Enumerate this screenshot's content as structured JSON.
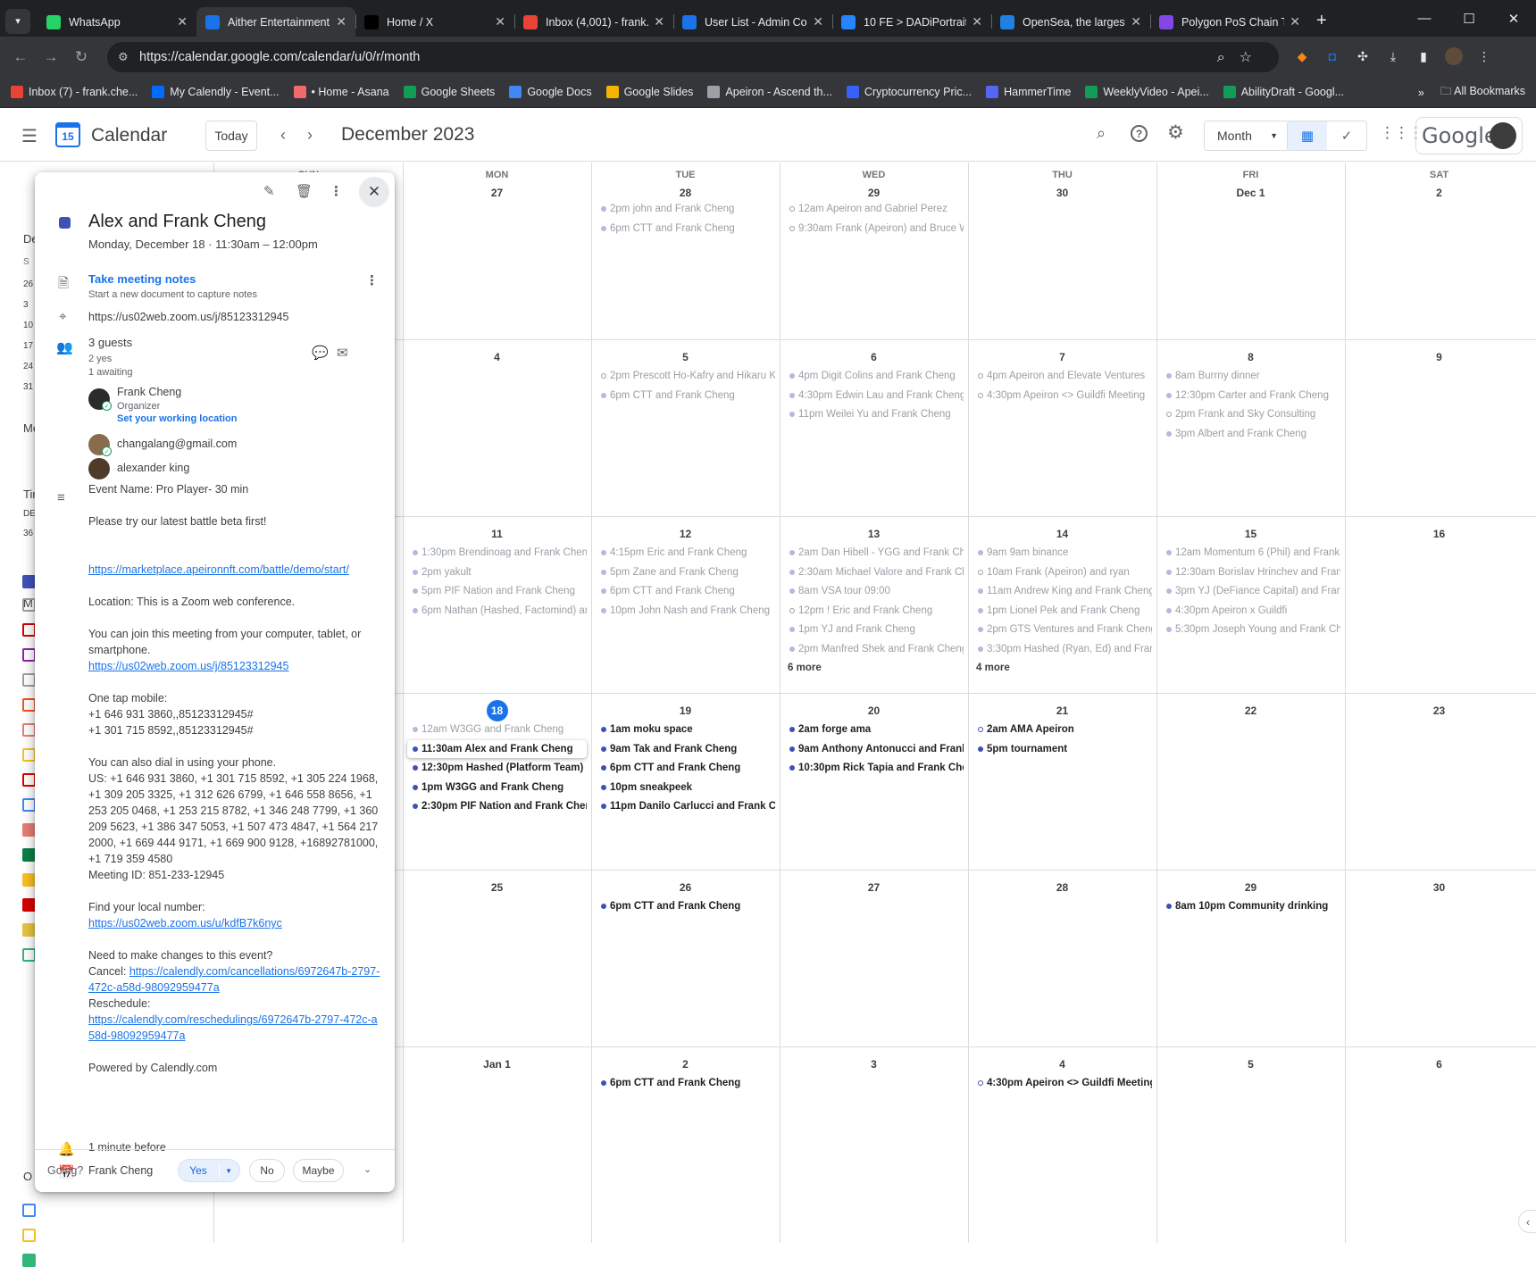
{
  "browser": {
    "tabs": [
      {
        "title": "WhatsApp",
        "icon": "whatsapp-icon",
        "color": "#25d366",
        "active": false
      },
      {
        "title": "Aither Entertainment",
        "icon": "calendar-icon",
        "color": "#1a73e8",
        "active": true
      },
      {
        "title": "Home / X",
        "icon": "x-icon",
        "color": "#000000",
        "active": false
      },
      {
        "title": "Inbox (4,001) - frank.",
        "icon": "gmail-icon",
        "color": "#ea4335",
        "active": false
      },
      {
        "title": "User List - Admin Co",
        "icon": "admin-icon",
        "color": "#1a73e8",
        "active": false
      },
      {
        "title": "10 FE > DADiPortrait",
        "icon": "jira-icon",
        "color": "#2684ff",
        "active": false
      },
      {
        "title": "OpenSea, the largest",
        "icon": "opensea-icon",
        "color": "#2081e2",
        "active": false
      },
      {
        "title": "Polygon PoS Chain Tr",
        "icon": "polygon-icon",
        "color": "#8247e5",
        "active": false
      }
    ],
    "url": "https://calendar.google.com/calendar/u/0/r/month",
    "bookmarks": [
      {
        "label": "Inbox (7) - frank.che...",
        "color": "#ea4335"
      },
      {
        "label": "My Calendly - Event...",
        "color": "#006bff"
      },
      {
        "label": "• Home - Asana",
        "color": "#f06a6a"
      },
      {
        "label": "Google Sheets",
        "color": "#0f9d58"
      },
      {
        "label": "Google Docs",
        "color": "#4285f4"
      },
      {
        "label": "Google Slides",
        "color": "#f4b400"
      },
      {
        "label": "Apeiron - Ascend th...",
        "color": "#9aa0a6"
      },
      {
        "label": "Cryptocurrency Pric...",
        "color": "#3861fb"
      },
      {
        "label": "HammerTime",
        "color": "#5865f2"
      },
      {
        "label": "WeeklyVideo - Apei...",
        "color": "#0f9d58"
      },
      {
        "label": "AbilityDraft - Googl...",
        "color": "#0f9d58"
      }
    ],
    "all_bookmarks": "All Bookmarks",
    "overflow": "»"
  },
  "header": {
    "app_title": "Calendar",
    "logo_day": "15",
    "today_button": "Today",
    "month_title": "December 2023",
    "view_select": "Month",
    "google_wordmark": "Google"
  },
  "sidebar_peek": {
    "month_letter": "De",
    "dow": "S",
    "weeks": [
      "26",
      "3",
      "10",
      "17",
      "24",
      "31"
    ],
    "sec1": "Me",
    "sec2": "Tir",
    "sec2b": "DE",
    "sec2c": "36",
    "sec3": "M",
    "sec4": "O",
    "checkbox_colors": [
      "#3f51b5",
      "#9aa0a6",
      "#d50000",
      "#8e24aa",
      "#9aa0a6",
      "#f4511e",
      "#e67c73",
      "#f6bf26",
      "#d50000",
      "#4285f4",
      "#e67c73",
      "#0b8043",
      "#f6bf26",
      "#d50000",
      "#e4c441",
      "#33b679",
      "#4285f4",
      "#f6bf26",
      "#33b679"
    ]
  },
  "grid": {
    "weekday_headers": [
      "SUN",
      "MON",
      "TUE",
      "WED",
      "THU",
      "FRI",
      "SAT"
    ],
    "weeks": [
      {
        "days": [
          "26",
          "27",
          "28",
          "29",
          "30",
          "Dec 1",
          "2"
        ]
      },
      {
        "days": [
          "3",
          "4",
          "5",
          "6",
          "7",
          "8",
          "9"
        ]
      },
      {
        "days": [
          "10",
          "11",
          "12",
          "13",
          "14",
          "15",
          "16"
        ]
      },
      {
        "days": [
          "17",
          "18",
          "19",
          "20",
          "21",
          "22",
          "23"
        ]
      },
      {
        "days": [
          "24",
          "25",
          "26",
          "27",
          "28",
          "29",
          "30"
        ]
      },
      {
        "days": [
          "31",
          "Jan 1",
          "2",
          "3",
          "4",
          "5",
          "6"
        ]
      }
    ],
    "today": {
      "week": 3,
      "col": 1
    },
    "events": [
      {
        "w": 0,
        "c": 2,
        "i": 0,
        "time": "2pm",
        "title": "john and Frank Cheng",
        "kind": "past"
      },
      {
        "w": 0,
        "c": 2,
        "i": 1,
        "time": "6pm",
        "title": "CTT and Frank Cheng",
        "kind": "past"
      },
      {
        "w": 0,
        "c": 3,
        "i": 0,
        "time": "12am",
        "title": "Apeiron and Gabriel Perez",
        "kind": "past pend"
      },
      {
        "w": 0,
        "c": 3,
        "i": 1,
        "time": "9:30am",
        "title": "Frank (Apeiron) and Bruce Wa",
        "kind": "past pend"
      },
      {
        "w": 1,
        "c": 2,
        "i": 0,
        "time": "2pm",
        "title": "Prescott Ho-Kafry and Hikaru Ka",
        "kind": "past pend"
      },
      {
        "w": 1,
        "c": 2,
        "i": 1,
        "time": "6pm",
        "title": "CTT and Frank Cheng",
        "kind": "past"
      },
      {
        "w": 1,
        "c": 3,
        "i": 0,
        "time": "4pm",
        "title": "Digit Colins and Frank Cheng",
        "kind": "past"
      },
      {
        "w": 1,
        "c": 3,
        "i": 1,
        "time": "4:30pm",
        "title": "Edwin Lau and Frank Cheng",
        "kind": "past"
      },
      {
        "w": 1,
        "c": 3,
        "i": 2,
        "time": "11pm",
        "title": "Weilei Yu and Frank Cheng",
        "kind": "past"
      },
      {
        "w": 1,
        "c": 4,
        "i": 0,
        "time": "4pm",
        "title": "Apeiron and Elevate Ventures",
        "kind": "past pend"
      },
      {
        "w": 1,
        "c": 4,
        "i": 1,
        "time": "4:30pm",
        "title": "Apeiron <> Guildfi Meeting",
        "kind": "past pend"
      },
      {
        "w": 1,
        "c": 5,
        "i": 0,
        "time": "8am",
        "title": "Burrny dinner",
        "kind": "past"
      },
      {
        "w": 1,
        "c": 5,
        "i": 1,
        "time": "12:30pm",
        "title": "Carter and Frank Cheng",
        "kind": "past"
      },
      {
        "w": 1,
        "c": 5,
        "i": 2,
        "time": "2pm",
        "title": "Frank and Sky Consulting",
        "kind": "past pend"
      },
      {
        "w": 1,
        "c": 5,
        "i": 3,
        "time": "3pm",
        "title": "Albert and Frank Cheng",
        "kind": "past"
      },
      {
        "w": 2,
        "c": 1,
        "i": 0,
        "time": "1:30pm",
        "title": "Brendinoag and Frank Cheng",
        "kind": "past"
      },
      {
        "w": 2,
        "c": 1,
        "i": 1,
        "time": "2pm",
        "title": "yakult",
        "kind": "past"
      },
      {
        "w": 2,
        "c": 1,
        "i": 2,
        "time": "5pm",
        "title": "PIF Nation and Frank Cheng",
        "kind": "past"
      },
      {
        "w": 2,
        "c": 1,
        "i": 3,
        "time": "6pm",
        "title": "Nathan (Hashed, Factomind) and",
        "kind": "past"
      },
      {
        "w": 2,
        "c": 2,
        "i": 0,
        "time": "4:15pm",
        "title": "Eric and Frank Cheng",
        "kind": "past"
      },
      {
        "w": 2,
        "c": 2,
        "i": 1,
        "time": "5pm",
        "title": "Zane and Frank Cheng",
        "kind": "past"
      },
      {
        "w": 2,
        "c": 2,
        "i": 2,
        "time": "6pm",
        "title": "CTT and Frank Cheng",
        "kind": "past"
      },
      {
        "w": 2,
        "c": 2,
        "i": 3,
        "time": "10pm",
        "title": "John Nash and Frank Cheng",
        "kind": "past"
      },
      {
        "w": 2,
        "c": 3,
        "i": 0,
        "time": "2am",
        "title": "Dan Hibell - YGG and Frank Cheng",
        "kind": "past"
      },
      {
        "w": 2,
        "c": 3,
        "i": 1,
        "time": "2:30am",
        "title": "Michael Valore and Frank Che",
        "kind": "past"
      },
      {
        "w": 2,
        "c": 3,
        "i": 2,
        "time": "8am",
        "title": "VSA tour 09:00",
        "kind": "past"
      },
      {
        "w": 2,
        "c": 3,
        "i": 3,
        "time": "12pm",
        "title": "! Eric and Frank Cheng",
        "kind": "past pend"
      },
      {
        "w": 2,
        "c": 3,
        "i": 4,
        "time": "1pm",
        "title": "YJ and Frank Cheng",
        "kind": "past"
      },
      {
        "w": 2,
        "c": 3,
        "i": 5,
        "time": "2pm",
        "title": "Manfred Shek and Frank Cheng",
        "kind": "past"
      },
      {
        "w": 2,
        "c": 4,
        "i": 0,
        "time": "9am",
        "title": "9am binance",
        "kind": "past"
      },
      {
        "w": 2,
        "c": 4,
        "i": 1,
        "time": "10am",
        "title": "Frank (Apeiron) and ryan",
        "kind": "past pend"
      },
      {
        "w": 2,
        "c": 4,
        "i": 2,
        "time": "11am",
        "title": "Andrew King and Frank Cheng",
        "kind": "past"
      },
      {
        "w": 2,
        "c": 4,
        "i": 3,
        "time": "1pm",
        "title": "Lionel Pek and Frank Cheng",
        "kind": "past"
      },
      {
        "w": 2,
        "c": 4,
        "i": 4,
        "time": "2pm",
        "title": "GTS Ventures and Frank Cheng",
        "kind": "past"
      },
      {
        "w": 2,
        "c": 4,
        "i": 5,
        "time": "3:30pm",
        "title": "Hashed (Ryan, Ed) and Frank C",
        "kind": "past"
      },
      {
        "w": 2,
        "c": 5,
        "i": 0,
        "time": "12am",
        "title": "Momentum 6 (Phil) and Frank C",
        "kind": "past"
      },
      {
        "w": 2,
        "c": 5,
        "i": 1,
        "time": "12:30am",
        "title": "Borislav Hrinchev and Frank",
        "kind": "past"
      },
      {
        "w": 2,
        "c": 5,
        "i": 2,
        "time": "3pm",
        "title": "YJ (DeFiance Capital) and Frank C",
        "kind": "past"
      },
      {
        "w": 2,
        "c": 5,
        "i": 3,
        "time": "4:30pm",
        "title": "Apeiron x Guildfi",
        "kind": "past"
      },
      {
        "w": 2,
        "c": 5,
        "i": 4,
        "time": "5:30pm",
        "title": "Joseph Young and Frank Cher",
        "kind": "past"
      },
      {
        "w": 3,
        "c": 1,
        "i": 0,
        "time": "12am",
        "title": "W3GG and Frank Cheng",
        "kind": "past"
      },
      {
        "w": 3,
        "c": 1,
        "i": 1,
        "time": "11:30am",
        "title": "Alex and Frank Cheng",
        "kind": "sel"
      },
      {
        "w": 3,
        "c": 1,
        "i": 2,
        "time": "12:30pm",
        "title": "Hashed (Platform Team) <> A",
        "kind": "fut"
      },
      {
        "w": 3,
        "c": 1,
        "i": 3,
        "time": "1pm",
        "title": "W3GG and Frank Cheng",
        "kind": "fut"
      },
      {
        "w": 3,
        "c": 1,
        "i": 4,
        "time": "2:30pm",
        "title": "PIF Nation and Frank Cheng",
        "kind": "fut"
      },
      {
        "w": 3,
        "c": 2,
        "i": 0,
        "time": "1am",
        "title": "moku space",
        "kind": "fut"
      },
      {
        "w": 3,
        "c": 2,
        "i": 1,
        "time": "9am",
        "title": "Tak and Frank Cheng",
        "kind": "fut"
      },
      {
        "w": 3,
        "c": 2,
        "i": 2,
        "time": "6pm",
        "title": "CTT and Frank Cheng",
        "kind": "fut"
      },
      {
        "w": 3,
        "c": 2,
        "i": 3,
        "time": "10pm",
        "title": "sneakpeek",
        "kind": "fut"
      },
      {
        "w": 3,
        "c": 2,
        "i": 4,
        "time": "11pm",
        "title": "Danilo Carlucci and Frank Chen",
        "kind": "fut"
      },
      {
        "w": 3,
        "c": 3,
        "i": 0,
        "time": "2am",
        "title": "forge ama",
        "kind": "fut"
      },
      {
        "w": 3,
        "c": 3,
        "i": 1,
        "time": "9am",
        "title": "Anthony Antonucci and Frank Ch",
        "kind": "fut"
      },
      {
        "w": 3,
        "c": 3,
        "i": 2,
        "time": "10:30pm",
        "title": "Rick Tapia and Frank Cheng",
        "kind": "fut"
      },
      {
        "w": 3,
        "c": 4,
        "i": 0,
        "time": "2am",
        "title": "AMA Apeiron",
        "kind": "fut pend"
      },
      {
        "w": 3,
        "c": 4,
        "i": 1,
        "time": "5pm",
        "title": "tournament",
        "kind": "fut"
      },
      {
        "w": 4,
        "c": 2,
        "i": 0,
        "time": "6pm",
        "title": "CTT and Frank Cheng",
        "kind": "fut"
      },
      {
        "w": 4,
        "c": 5,
        "i": 0,
        "time": "8am",
        "title": "10pm Community drinking",
        "kind": "fut"
      },
      {
        "w": 5,
        "c": 2,
        "i": 0,
        "time": "6pm",
        "title": "CTT and Frank Cheng",
        "kind": "fut"
      },
      {
        "w": 5,
        "c": 4,
        "i": 0,
        "time": "4:30pm",
        "title": "Apeiron <> Guildfi Meeting",
        "kind": "fut pend"
      }
    ],
    "more_links": [
      {
        "w": 2,
        "c": 3,
        "label": "6 more"
      },
      {
        "w": 2,
        "c": 4,
        "label": "4 more"
      }
    ]
  },
  "popup": {
    "title": "Alex and Frank Cheng",
    "when": "Monday, December 18  ·  11:30am – 12:00pm",
    "event_color": "#3f51b5",
    "notes_link": "Take meeting notes",
    "notes_sub": "Start a new document to capture notes",
    "location": "https://us02web.zoom.us/j/85123312945",
    "guests_count": "3 guests",
    "guests_yes": "2 yes",
    "guests_awaiting": "1 awaiting",
    "guests": [
      {
        "name": "Frank Cheng",
        "role": "Organizer",
        "extra": "Set your working location"
      },
      {
        "name": "changalang@gmail.com"
      },
      {
        "name": "alexander king"
      }
    ],
    "description": [
      {
        "t": "Event Name: Pro Player- 30 min"
      },
      {
        "t": ""
      },
      {
        "t": "Please try our latest battle beta first!"
      },
      {
        "t": ""
      },
      {
        "t": ""
      },
      {
        "link": "https://marketplace.apeironnft.com/battle/demo/start/"
      },
      {
        "t": ""
      },
      {
        "t": "Location: This is a Zoom web conference."
      },
      {
        "t": ""
      },
      {
        "t": "You can join this meeting from your computer, tablet, or smartphone."
      },
      {
        "link": "https://us02web.zoom.us/j/85123312945"
      },
      {
        "t": ""
      },
      {
        "t": "One tap mobile:"
      },
      {
        "t": "+1 646 931 3860,,85123312945#"
      },
      {
        "t": "+1 301 715 8592,,85123312945#"
      },
      {
        "t": ""
      },
      {
        "t": "You can also dial in using your phone."
      },
      {
        "t": "US: +1 646 931 3860, +1 301 715 8592, +1 305 224 1968, +1 309 205 3325, +1 312 626 6799, +1 646 558 8656, +1 253 205 0468, +1 253 215 8782, +1 346 248 7799, +1 360 209 5623, +1 386 347 5053, +1 507 473 4847, +1 564 217 2000, +1 669 444 9171, +1 669 900 9128, +16892781000, +1 719 359 4580"
      },
      {
        "t": "Meeting ID: 851-233-12945"
      },
      {
        "t": ""
      },
      {
        "t": "Find your local number:"
      },
      {
        "link": "https://us02web.zoom.us/u/kdfB7k6nyc"
      },
      {
        "t": ""
      },
      {
        "t": "Need to make changes to this event?"
      },
      {
        "pre": "Cancel: ",
        "link": "https://calendly.com/cancellations/6972647b-2797-472c-a58d-98092959477a"
      },
      {
        "t": "Reschedule:"
      },
      {
        "link": "https://calendly.com/reschedulings/6972647b-2797-472c-a58d-98092959477a"
      },
      {
        "t": ""
      },
      {
        "t": "Powered by Calendly.com"
      }
    ],
    "reminder": "1 minute before",
    "calendar_owner": "Frank Cheng",
    "going_label": "Going?",
    "rsvp_yes": "Yes",
    "rsvp_no": "No",
    "rsvp_maybe": "Maybe"
  }
}
